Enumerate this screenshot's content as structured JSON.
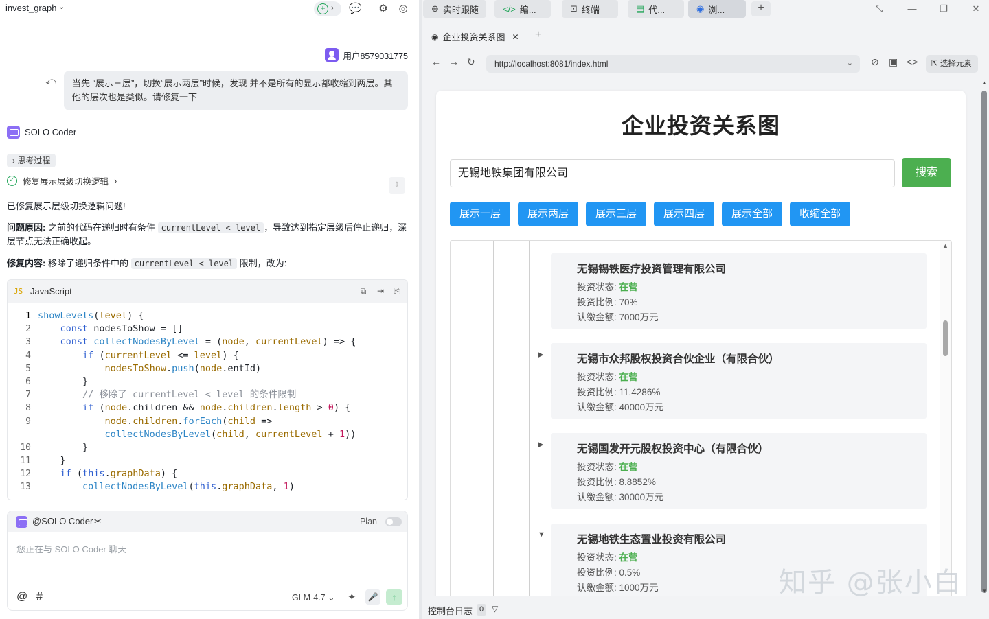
{
  "left_panel": {
    "project_name": "invest_graph",
    "user_name": "用户8579031775",
    "user_message": "当先 “展示三层”，切换“展示两层”时候，发现 并不是所有的显示都收缩到两层。其他的层次也是类似。请修复一下",
    "agent_name": "SOLO Coder",
    "thinking_chip": "思考过程",
    "step_label": "修复展示层级切换逻辑",
    "reply": {
      "line1": "已修复展示层级切换逻辑问题!",
      "cause_label": "问题原因:",
      "cause_text1": "之前的代码在递归时有条件",
      "cause_code": "currentLevel < level",
      "cause_text2": "，导致达到指定层级后停止递归，深层节点无法正确收起。",
      "fix_label": "修复内容:",
      "fix_text1": "移除了递归条件中的",
      "fix_code": "currentLevel < level",
      "fix_text2": "限制，改为:"
    },
    "code_block": {
      "badge": "JS",
      "language": "JavaScript",
      "line_numbers": [
        "1",
        "2",
        "3",
        "4",
        "5",
        "6",
        "7",
        "8",
        "9",
        "",
        "10",
        "11",
        "12",
        "13"
      ]
    },
    "chat_input": {
      "mention": "@SOLO Coder",
      "plan_label": "Plan",
      "placeholder": "您正在与 SOLO Coder 聊天",
      "at_symbol": "@",
      "hash_symbol": "#",
      "model": "GLM-4.7"
    }
  },
  "right_panel": {
    "top_tabs": [
      "实时跟随",
      "编...",
      "终端",
      "代...",
      "浏..."
    ],
    "browser_tab_title": "企业投资关系图",
    "url": "http://localhost:8081/index.html",
    "pick_element_label": "选择元素",
    "page": {
      "title": "企业投资关系图",
      "search_value": "无锡地铁集团有限公司",
      "search_button": "搜索",
      "level_buttons": [
        "展示一层",
        "展示两层",
        "展示三层",
        "展示四层",
        "展示全部",
        "收缩全部"
      ],
      "status_color": "#4caf50",
      "button_color": "#2196f3",
      "nodes": [
        {
          "toggle": "",
          "name": "无锡锡铁医疗投资管理有限公司",
          "status_label": "投资状态:",
          "status": "在营",
          "ratio_label": "投资比例:",
          "ratio": "70%",
          "amount_label": "认缴金额:",
          "amount": "7000万元"
        },
        {
          "toggle": "▶",
          "name": "无锡市众邦股权投资合伙企业（有限合伙）",
          "status_label": "投资状态:",
          "status": "在营",
          "ratio_label": "投资比例:",
          "ratio": "11.4286%",
          "amount_label": "认缴金额:",
          "amount": "40000万元"
        },
        {
          "toggle": "▶",
          "name": "无锡国发开元股权投资中心（有限合伙）",
          "status_label": "投资状态:",
          "status": "在营",
          "ratio_label": "投资比例:",
          "ratio": "8.8852%",
          "amount_label": "认缴金额:",
          "amount": "30000万元"
        },
        {
          "toggle": "▼",
          "name": "无锡地铁生态置业投资有限公司",
          "status_label": "投资状态:",
          "status": "在营",
          "ratio_label": "投资比例:",
          "ratio": "0.5%",
          "amount_label": "认缴金额:",
          "amount": "1000万元"
        }
      ]
    },
    "console": {
      "label": "控制台日志",
      "count": "0"
    }
  },
  "watermark": "知乎 @张小白"
}
